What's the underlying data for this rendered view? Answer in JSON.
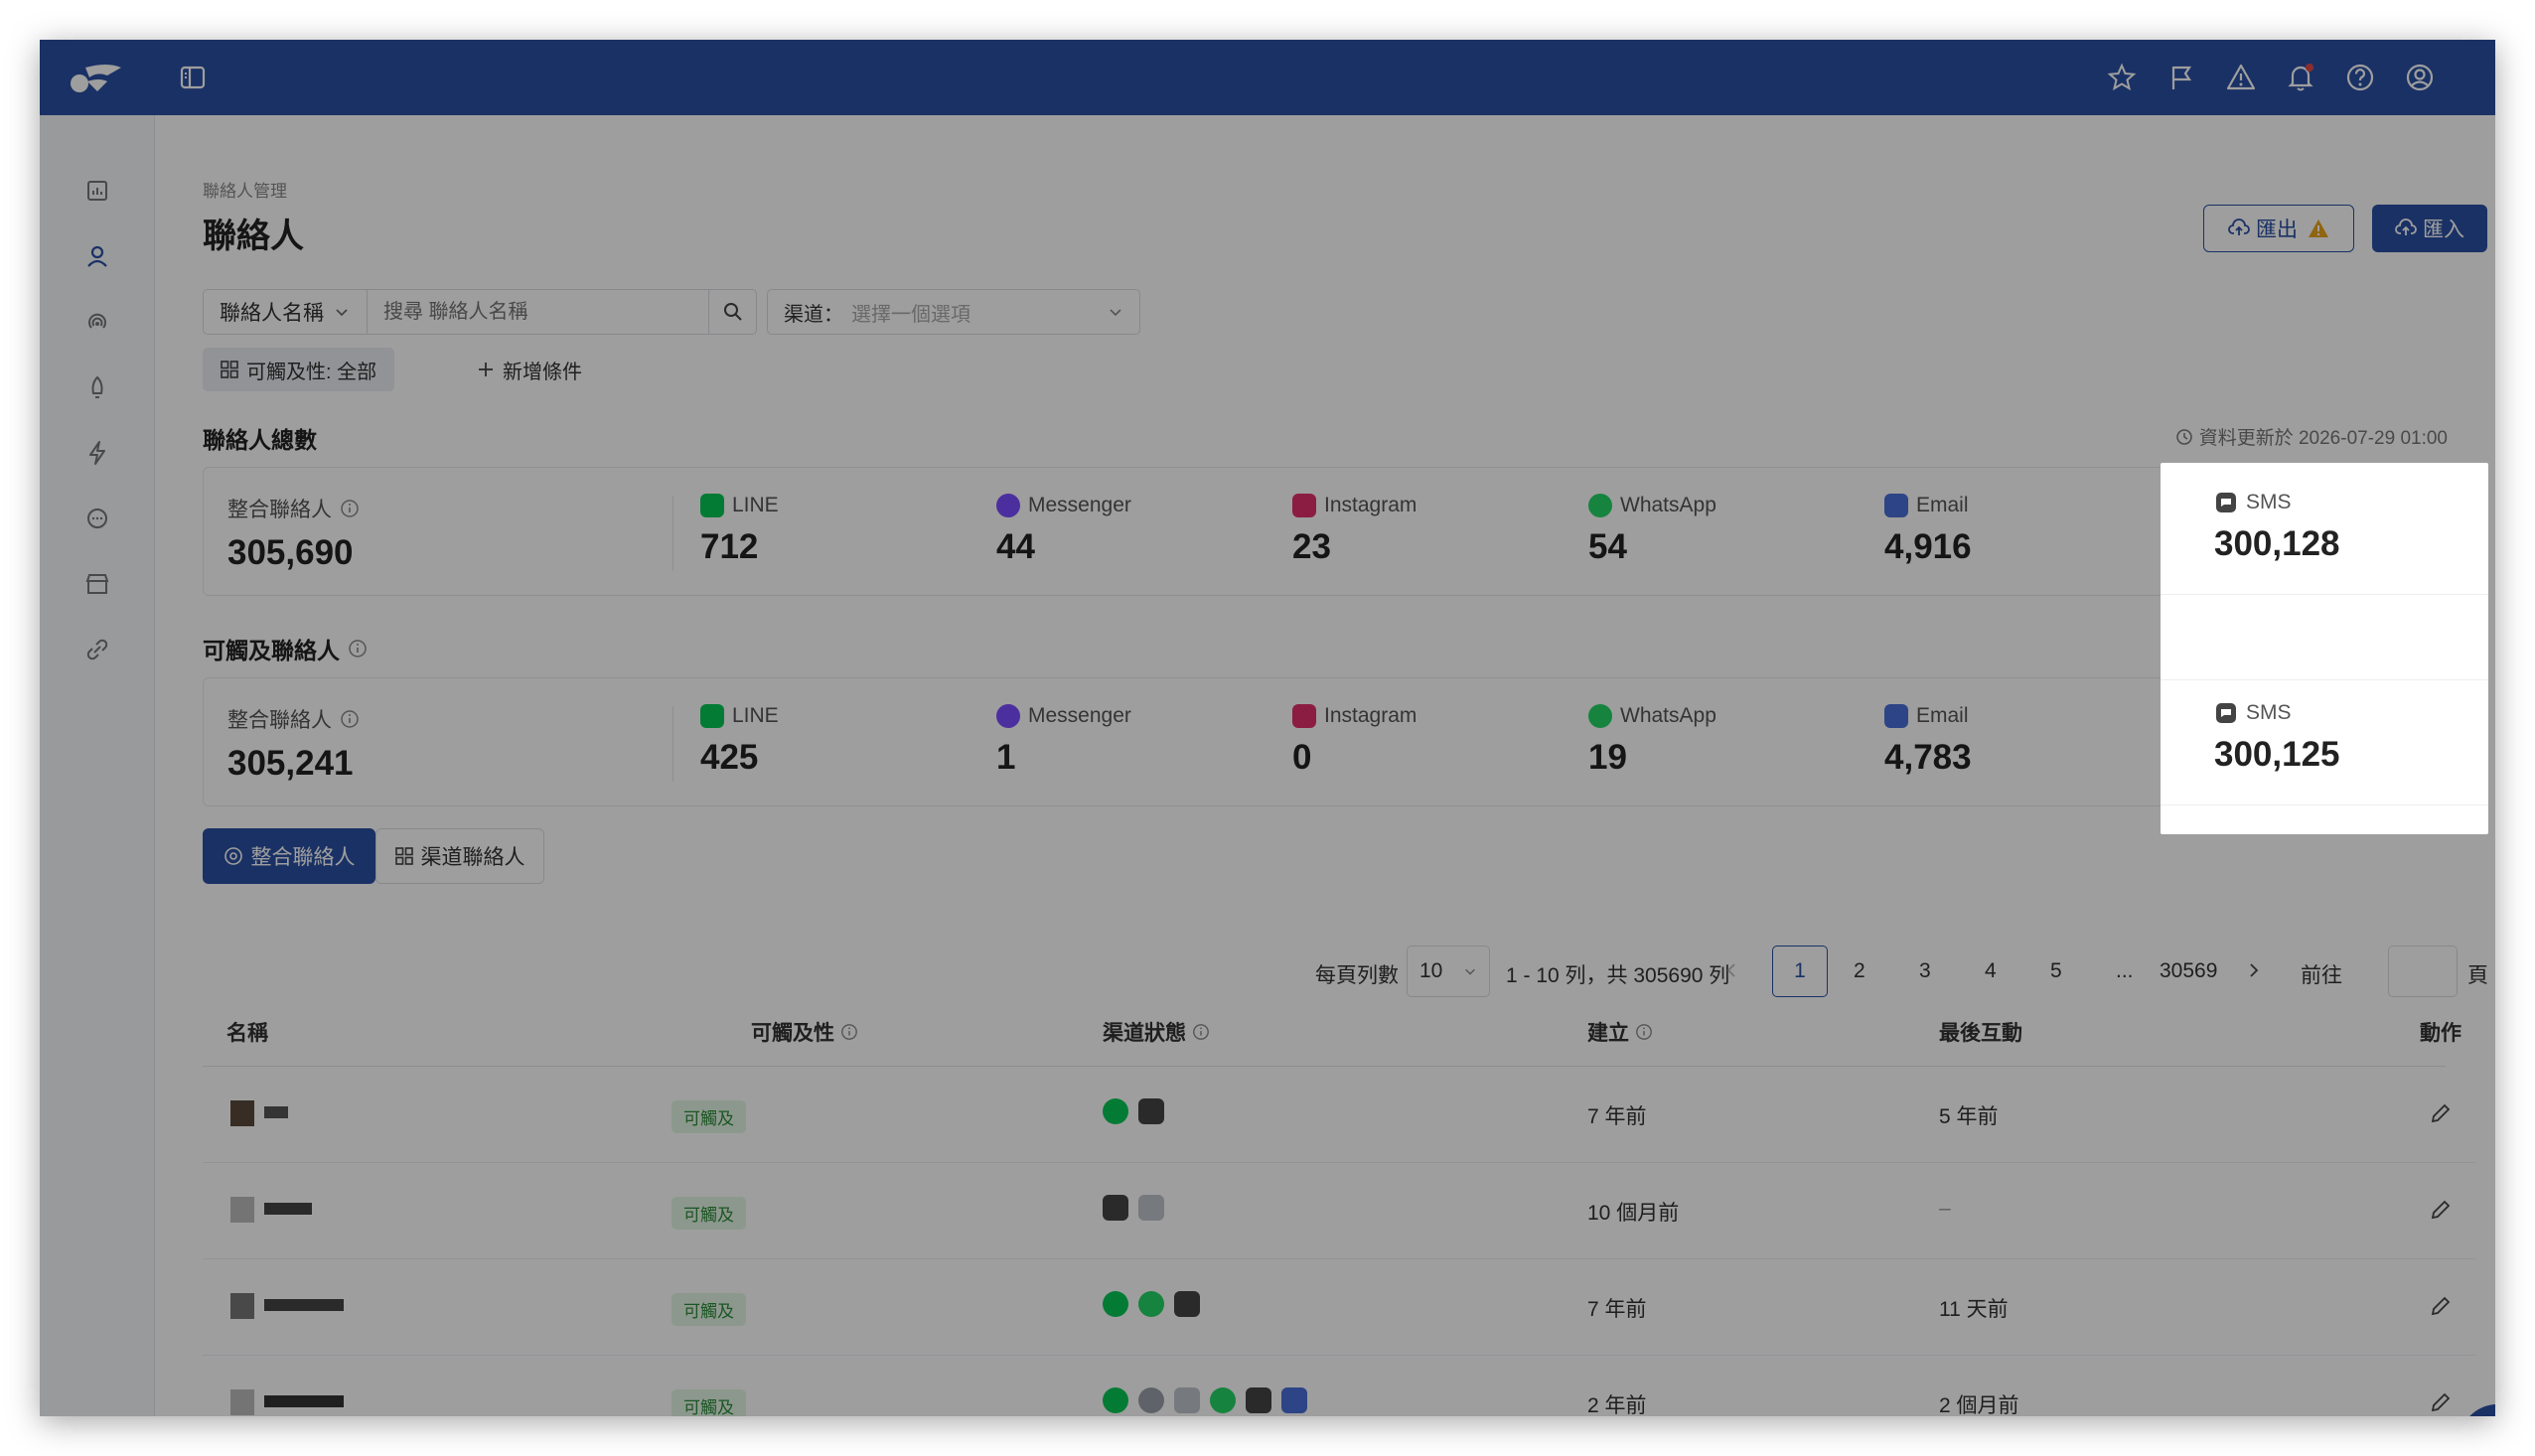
{
  "breadcrumb": "聯絡人管理",
  "page_title": "聯絡人",
  "actions": {
    "export": "匯出",
    "import": "匯入"
  },
  "filter": {
    "field": "聯絡人名稱",
    "search_placeholder": "搜尋 聯絡人名稱",
    "channel_label": "渠道：",
    "channel_placeholder": "選擇一個選項",
    "reach_chip": "可觸及性: 全部",
    "add_condition": "新增條件"
  },
  "total_section": {
    "title": "聯絡人總數",
    "updated": "資料更新於 2026-07-29 01:00",
    "stats": [
      {
        "label": "整合聯絡人",
        "value": "305,690"
      },
      {
        "label": "LINE",
        "value": "712"
      },
      {
        "label": "Messenger",
        "value": "44"
      },
      {
        "label": "Instagram",
        "value": "23"
      },
      {
        "label": "WhatsApp",
        "value": "54"
      },
      {
        "label": "Email",
        "value": "4,916"
      },
      {
        "label": "SMS",
        "value": "300,128"
      }
    ]
  },
  "reach_section": {
    "title": "可觸及聯絡人",
    "stats": [
      {
        "label": "整合聯絡人",
        "value": "305,241"
      },
      {
        "label": "LINE",
        "value": "425"
      },
      {
        "label": "Messenger",
        "value": "1"
      },
      {
        "label": "Instagram",
        "value": "0"
      },
      {
        "label": "WhatsApp",
        "value": "19"
      },
      {
        "label": "Email",
        "value": "4,783"
      },
      {
        "label": "SMS",
        "value": "300,125"
      }
    ]
  },
  "tabs": {
    "integrated": "整合聯絡人",
    "channel": "渠道聯絡人"
  },
  "pagination": {
    "per_page_label": "每頁列數",
    "per_page": "10",
    "range": "1 - 10 列，共 305690 列",
    "pages": [
      "1",
      "2",
      "3",
      "4",
      "5"
    ],
    "ellipsis": "...",
    "last": "30569",
    "goto": "前往",
    "page_suffix": "頁"
  },
  "table": {
    "headers": {
      "name": "名稱",
      "reach": "可觸及性",
      "channel": "渠道狀態",
      "created": "建立",
      "last": "最後互動",
      "action": "動作"
    },
    "rows": [
      {
        "reach": "可觸及",
        "created": "7 年前",
        "last": "5 年前"
      },
      {
        "reach": "可觸及",
        "created": "10 個月前",
        "last": "–"
      },
      {
        "reach": "可觸及",
        "created": "7 年前",
        "last": "11 天前"
      },
      {
        "reach": "可觸及",
        "created": "2 年前",
        "last": "2 個月前"
      }
    ]
  },
  "colors": {
    "header": "#2a4fa3",
    "primary": "#2a4fa3",
    "line": "#06c755",
    "messenger": "#7b4cff",
    "instagram": "#e1306c",
    "whatsapp": "#25d366",
    "email": "#4a6fd8",
    "sms": "#444444",
    "warning": "#e8a31a"
  }
}
